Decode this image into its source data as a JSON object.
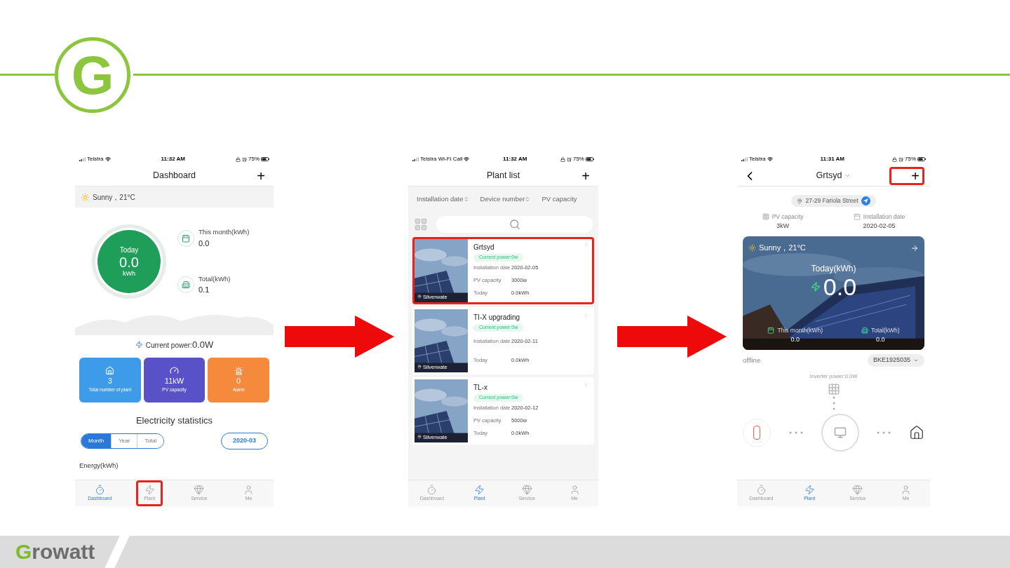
{
  "header": {
    "logo_letter": "G"
  },
  "phones": [
    {
      "kind": "dashboard",
      "status_bar": {
        "carrier": "Telstra",
        "time": "11:32 AM",
        "battery": "75%"
      },
      "title": "Dashboard",
      "action": {
        "label": "+",
        "highlighted": false
      },
      "weather": "Sunny，21°C",
      "today": {
        "label": "Today",
        "value": "0.0",
        "unit": "kWh"
      },
      "stats": [
        {
          "kind": "month",
          "label": "This month(kWh)",
          "value": "0.0"
        },
        {
          "kind": "total",
          "label": "Total(kWh)",
          "value": "0.1"
        }
      ],
      "current_power": {
        "label": "Current power:",
        "value": "0.0W"
      },
      "tiles": [
        {
          "kind": "plants",
          "value": "3",
          "label": "Total number of plant",
          "color": "#3d9be9"
        },
        {
          "kind": "capacity",
          "value": "11kW",
          "label": "PV capacity",
          "color": "#5851c8"
        },
        {
          "kind": "alarm",
          "value": "0",
          "label": "Alarm",
          "color": "#f58a3c"
        }
      ],
      "section_title": "Electricity statistics",
      "periods": [
        {
          "label": "Month",
          "selected": true
        },
        {
          "label": "Year",
          "selected": false
        },
        {
          "label": "Total",
          "selected": false
        }
      ],
      "date": "2020-03",
      "chart_label": "Energy(kWh)",
      "nav": [
        {
          "kind": "dashboard",
          "label": "Dashboard",
          "selected": true,
          "highlighted": false
        },
        {
          "kind": "plant",
          "label": "Plant",
          "selected": false,
          "highlighted": true
        },
        {
          "kind": "service",
          "label": "Service",
          "selected": false,
          "highlighted": false
        },
        {
          "kind": "me",
          "label": "Me",
          "selected": false,
          "highlighted": false
        }
      ]
    },
    {
      "kind": "plant_list",
      "status_bar": {
        "carrier": "Telstra Wi-Fi Call",
        "time": "11:32 AM",
        "battery": "75%"
      },
      "title": "Plant list",
      "action": {
        "label": "+",
        "highlighted": false
      },
      "sort": [
        "Installation date",
        "Device number",
        "PV capacity"
      ],
      "plants": [
        {
          "name": "Grtsyd",
          "power": "Current power:0w",
          "location": "Silverwate",
          "highlighted": true,
          "rows": [
            {
              "label": "Installation date",
              "value": "2020-02-05"
            },
            {
              "label": "PV capacity",
              "value": "3000w"
            },
            {
              "label": "Today",
              "value": "0.0kWh"
            }
          ]
        },
        {
          "name": "TI-X upgrading",
          "power": "Current power:0w",
          "location": "Silverwate",
          "highlighted": false,
          "rows": [
            {
              "label": "Installation date",
              "value": "2020-02-11"
            },
            {
              "label": "Today",
              "value": "0.0kWh"
            }
          ]
        },
        {
          "name": "TL-x",
          "power": "Current power:0w",
          "location": "Silverwate",
          "highlighted": false,
          "rows": [
            {
              "label": "Installation date",
              "value": "2020-02-12"
            },
            {
              "label": "PV capacity",
              "value": "5000w"
            },
            {
              "label": "Today",
              "value": "0.0kWh"
            }
          ]
        }
      ],
      "nav": [
        {
          "kind": "dashboard",
          "label": "Dashboard",
          "selected": false,
          "highlighted": false
        },
        {
          "kind": "plant",
          "label": "Plant",
          "selected": true,
          "highlighted": false
        },
        {
          "kind": "service",
          "label": "Service",
          "selected": false,
          "highlighted": false
        },
        {
          "kind": "me",
          "label": "Me",
          "selected": false,
          "highlighted": false
        }
      ]
    },
    {
      "kind": "plant_detail",
      "status_bar": {
        "carrier": "Telstra",
        "time": "11:31 AM",
        "battery": "75%"
      },
      "title": "Grtsyd",
      "action": {
        "label": "+",
        "highlighted": true
      },
      "address": "27-29 Fariola Street",
      "info": [
        {
          "kind": "capacity",
          "label": "PV capacity",
          "value": "3kW"
        },
        {
          "kind": "date",
          "label": "Installation date",
          "value": "2020-02-05"
        }
      ],
      "weather": "Sunny，21°C",
      "today_label": "Today(kWh)",
      "today_value": "0.0",
      "stats": [
        {
          "kind": "month",
          "label": "This month(kWh)",
          "value": "0.0"
        },
        {
          "kind": "total",
          "label": "Total(kWh)",
          "value": "0.0"
        }
      ],
      "status": "offline",
      "device": "BKE1925035",
      "inverter_power": "Inverter power:0.0W",
      "nav": [
        {
          "kind": "dashboard",
          "label": "Dashboard",
          "selected": false,
          "highlighted": false
        },
        {
          "kind": "plant",
          "label": "Plant",
          "selected": true,
          "highlighted": false
        },
        {
          "kind": "service",
          "label": "Service",
          "selected": false,
          "highlighted": false
        },
        {
          "kind": "me",
          "label": "Me",
          "selected": false,
          "highlighted": false
        }
      ]
    }
  ],
  "footer": {
    "logo_initial": "G",
    "logo_rest": "rowatt"
  }
}
